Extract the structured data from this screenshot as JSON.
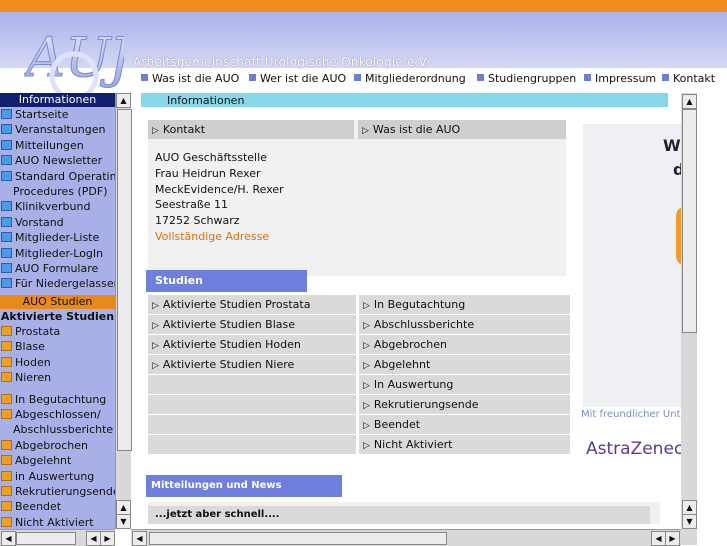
{
  "header": {
    "title": "Arbeitsgemeinschaft Urologische Onkologie e.V.",
    "logo_text": "AUO"
  },
  "topnav": [
    "Was ist die AUO",
    "Wer ist die AUO",
    "Mitgliederordnung",
    "Studiengruppen",
    "Impressum",
    "Kontakt"
  ],
  "sidebar": {
    "section1": "Informationen",
    "items1": [
      "Startseite",
      "Veranstaltungen",
      "Mitteilungen",
      "AUO Newsletter",
      "Standard Operating",
      "Procedures (PDF)",
      "Klinikverbund",
      "Vorstand",
      "Mitglieder-Liste",
      "Mitglieder-LogIn",
      "AUO Formulare",
      "Für Niedergelassene"
    ],
    "section2": "AUO Studien",
    "subhead": "Aktivierte Studien",
    "items2": [
      "Prostata",
      "Blase",
      "Hoden",
      "Nieren"
    ],
    "items3": [
      "In Begutachtung",
      "Abgeschlossen/",
      "Abschlussberichte",
      "Abgebrochen",
      "Abgelehnt",
      "in Auswertung",
      "Rekrutierungsende",
      "Beendet",
      "Nicht Aktiviert"
    ]
  },
  "main": {
    "info_label": "Informationen",
    "kontakt_tabs": [
      "Kontakt",
      "Was ist die AUO"
    ],
    "address": [
      "AUO Geschäftsstelle",
      "Frau Heidrun Rexer",
      "MeckEvidence/H. Rexer",
      "Seestraße 11",
      "17252 Schwarz"
    ],
    "address_link": "Vollständige Adresse",
    "studien_title": "Studien",
    "studien_left": [
      "Aktivierte Studien Prostata",
      "Aktivierte Studien Blase",
      "Aktivierte Studien Hoden",
      "Aktivierte Studien Niere",
      "",
      "",
      "",
      ""
    ],
    "studien_right": [
      "In Begutachtung",
      "Abschlussberichte",
      "Abgebrochen",
      "Abgelehnt",
      "In Auswertung",
      "Rekrutierungsende",
      "Beendet",
      "Nicht Aktiviert"
    ],
    "news_title": "Mitteilungen und News",
    "news_item": "...jetzt aber schnell...."
  },
  "ad": {
    "line1": "Wi",
    "line2": "d",
    "caption": "Mit freundlicher Unte",
    "brand": "AstraZeneca"
  },
  "colors": {
    "accent": "#f08c1e",
    "nav_head": "#111f6e",
    "sidebar_bg": "#a9b0e8",
    "studien_head": "#6e80dc",
    "link": "#d96e10"
  }
}
